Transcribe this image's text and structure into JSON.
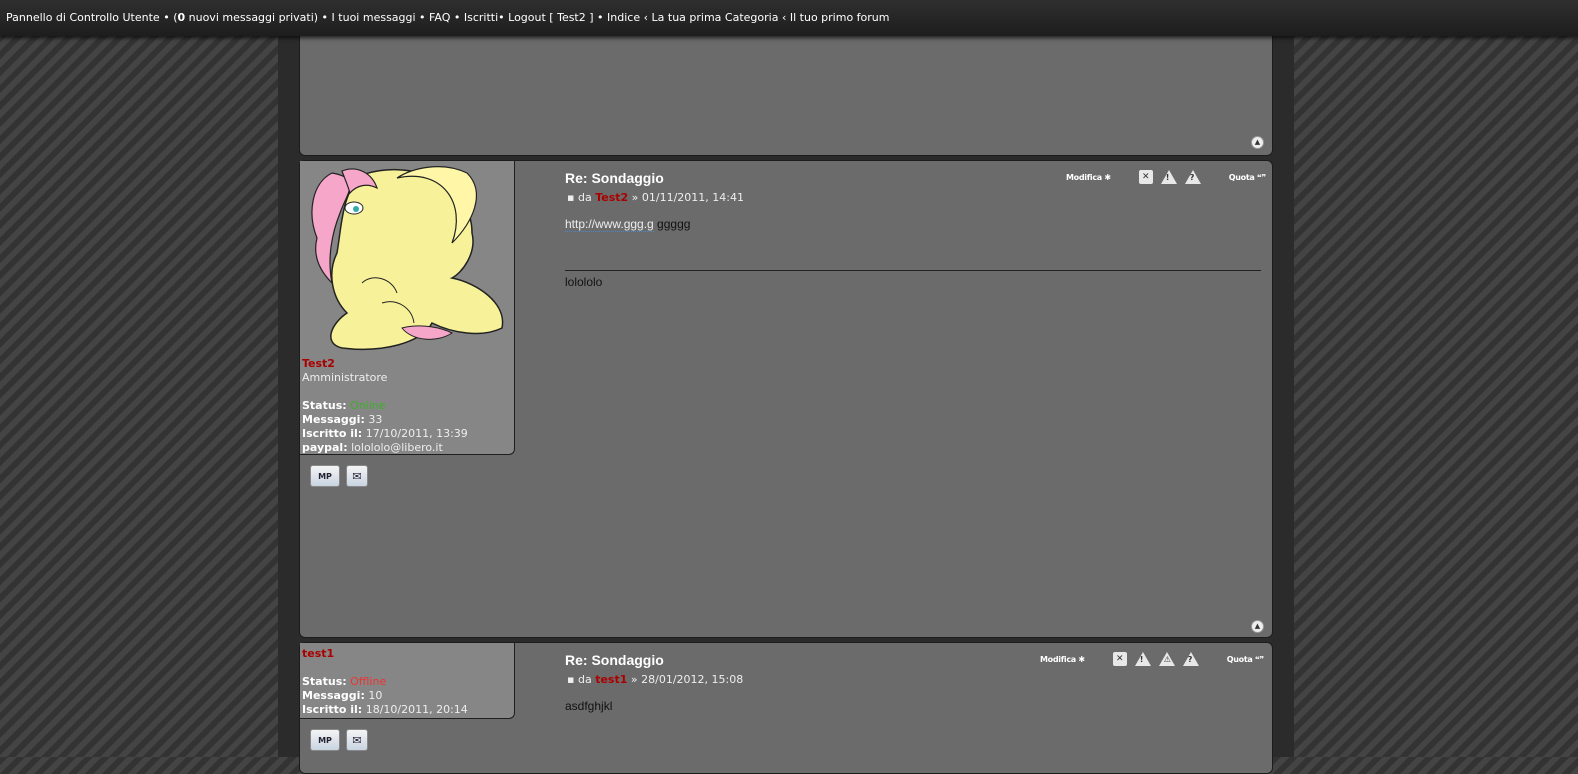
{
  "topbar": {
    "ucp": "Pannello di Controllo Utente",
    "sep": " • ",
    "pm_open": "(",
    "pm_count": "0",
    "pm_text": " nuovi messaggi privati)",
    "my_posts": "I tuoi messaggi",
    "faq": "FAQ",
    "members": "Iscritti",
    "logout": "Logout [ Test2 ]",
    "index": "Indice",
    "crumb_sep": " ‹ ",
    "category": "La tua prima Categoria",
    "forum": "Il tuo primo forum"
  },
  "post_tools": {
    "edit": "Modifica",
    "quote": "Quota",
    "delete_icon": "close-icon",
    "report_icon": "exclamation-icon",
    "warn_icon": "warning-icon",
    "help_icon": "question-icon",
    "to_top_icon": "arrow-up-icon"
  },
  "posts": [
    {
      "title": "Re: Sondaggio",
      "by": "da",
      "author": "Test2",
      "date": "» 01/11/2011, 14:41",
      "link": "http://www.ggg.g",
      "body_after_link": " ggggg",
      "signature": "lolololo",
      "profile": {
        "name": "Test2",
        "role": "Amministratore",
        "status_label": "Status:",
        "status": "Online",
        "posts_label": "Messaggi:",
        "posts": "33",
        "joined_label": "Iscritto il:",
        "joined": "17/10/2011, 13:39",
        "paypal_label": "paypal:",
        "paypal": "lolololo@libero.it"
      }
    },
    {
      "title": "Re: Sondaggio",
      "by": "da",
      "author": "test1",
      "date": "» 28/01/2012, 15:08",
      "body": "asdfghjkl",
      "profile": {
        "name": "test1",
        "status_label": "Status:",
        "status": "Offline",
        "posts_label": "Messaggi:",
        "posts": "10",
        "joined_label": "Iscritto il:",
        "joined": "18/10/2011, 20:14"
      }
    }
  ],
  "buttons": {
    "pm": "MP",
    "email": "✉"
  }
}
